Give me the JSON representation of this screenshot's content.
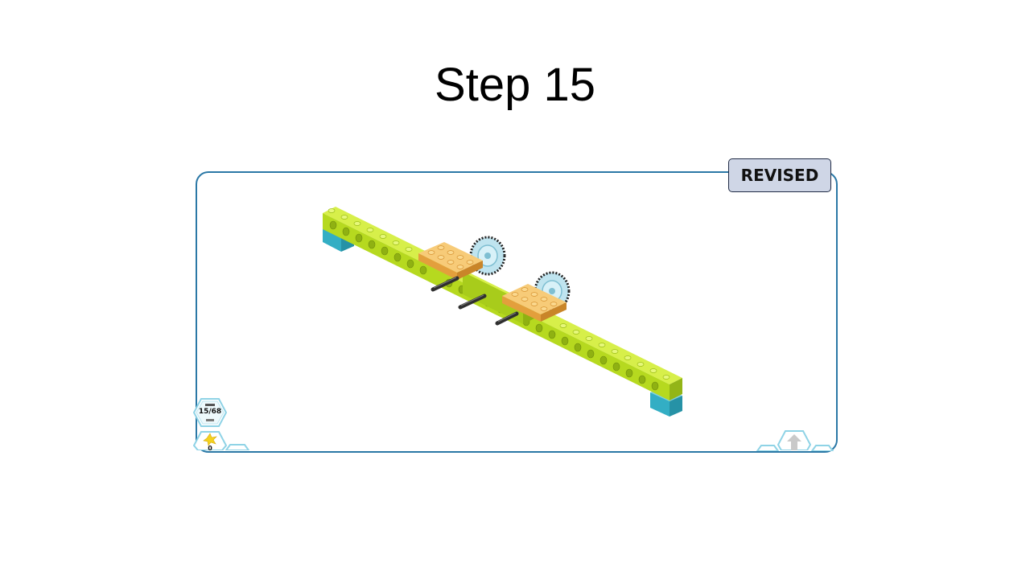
{
  "slide": {
    "title": "Step 15",
    "badge_label": "REVISED"
  },
  "step_counter": {
    "value": "15/68",
    "icon": "step-counter-icon"
  },
  "score": {
    "value": "0",
    "icon": "star-burst-icon"
  },
  "colors": {
    "frame_border": "#2b78a6",
    "badge_fill": "#cfd6e6",
    "beam_lime": "#b6d91f",
    "plate_orange": "#f2b65a",
    "block_teal": "#33aec4",
    "gear_lightblue": "#bfe4ef",
    "axle_dark": "#2f2f2f",
    "hex_outline": "#8fd3e6"
  },
  "icons": [
    "up-arrow-icon",
    "hex-nav-icon"
  ]
}
